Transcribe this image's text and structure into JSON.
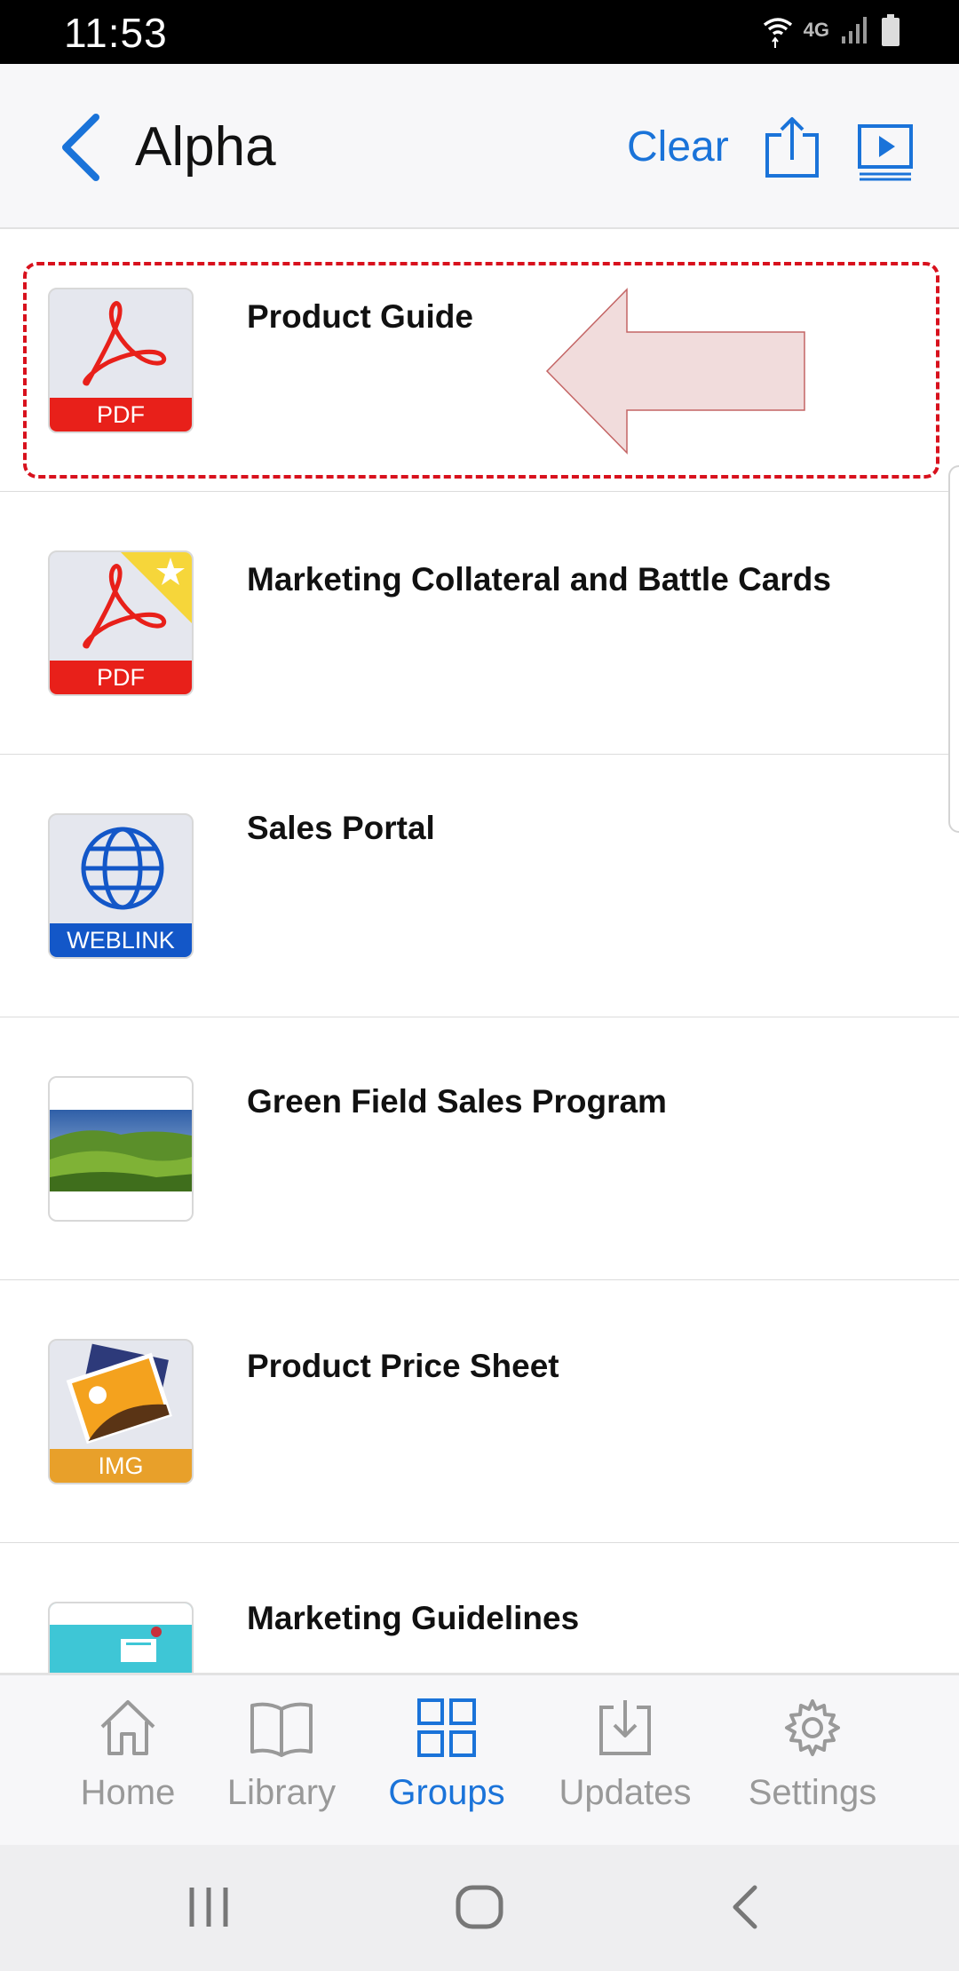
{
  "status_bar": {
    "time": "11:53",
    "network": "4G"
  },
  "header": {
    "title": "Alpha",
    "clear_label": "Clear"
  },
  "items": [
    {
      "name": "Product Guide",
      "badge": "PDF",
      "icon": "pdf-icon"
    },
    {
      "name": "Marketing Collateral and Battle Cards",
      "badge": "PDF",
      "icon": "pdf-icon",
      "starred": true
    },
    {
      "name": "Sales Portal",
      "badge": "WEBLINK",
      "icon": "globe-icon"
    },
    {
      "name": "Green Field Sales Program",
      "badge": "",
      "icon": "landscape-photo"
    },
    {
      "name": "Product Price Sheet",
      "badge": "IMG",
      "icon": "image-icon"
    },
    {
      "name": "Marketing Guidelines",
      "badge": "",
      "icon": "document-preview"
    }
  ],
  "bottom_nav": [
    {
      "label": "Home",
      "icon": "home-icon",
      "active": false
    },
    {
      "label": "Library",
      "icon": "book-icon",
      "active": false
    },
    {
      "label": "Groups",
      "icon": "grid-icon",
      "active": true
    },
    {
      "label": "Updates",
      "icon": "download-icon",
      "active": false
    },
    {
      "label": "Settings",
      "icon": "gear-icon",
      "active": false
    }
  ],
  "colors": {
    "accent": "#1a73d9",
    "pdf_red": "#e8201a",
    "weblink_blue": "#1357c8",
    "img_orange": "#e8a02a",
    "highlight_red": "#d8111d"
  }
}
